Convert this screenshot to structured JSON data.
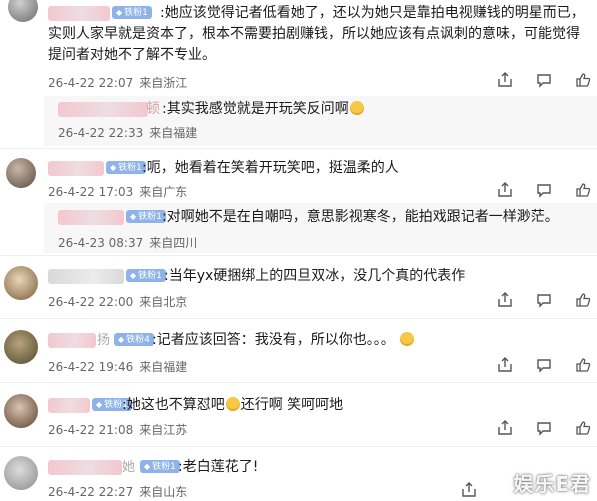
{
  "badge_icon": "diamond-icon",
  "comments": [
    {
      "badge": "铁粉1",
      "text": ":她应该觉得记者低看她了，还以为她只是靠拍电视赚钱的明星而已，实则人家早就是资本了，根本不需要拍剧赚钱，所以她应该有点讽刺的意味，可能觉得提问者对她不了解不专业。",
      "time": "26-4-22 22:07",
      "location": "来自浙江"
    },
    {
      "reply_to": "顿",
      "text": ":其实我感觉就是开玩笑反问啊",
      "time": "26-4-22 22:33",
      "location": "来自福建"
    },
    {
      "badge": "铁粉1",
      "text": ":呃，她看着在笑着开玩笑吧，挺温柔的人",
      "time": "26-4-22 17:03",
      "location": "来自广东"
    },
    {
      "badge": "铁粉1",
      "text": ":对啊她不是在自嘲吗，意思影视寒冬，能拍戏跟记者一样渺茫。",
      "time": "26-4-23 08:37",
      "location": "来自四川"
    },
    {
      "badge": "铁粉1",
      "text": ":当年yx硬捆绑上的四旦双冰，没几个真的代表作",
      "time": "26-4-22 22:00",
      "location": "来自北京"
    },
    {
      "name_suffix": "扬",
      "badge": "铁粉4",
      "text": ":记者应该回答：我没有，所以你也。。。",
      "time": "26-4-22 19:46",
      "location": "来自福建"
    },
    {
      "badge": "铁粉1",
      "text": ":她这也不算怼吧",
      "text2": "还行啊 笑呵呵地",
      "time": "26-4-22 21:08",
      "location": "来自江苏"
    },
    {
      "name_suffix": "她",
      "badge": "铁粉1",
      "text": ":老白莲花了!",
      "time": "26-4-22 22:27",
      "location": "来自山东"
    }
  ],
  "watermark": "娱乐E君"
}
